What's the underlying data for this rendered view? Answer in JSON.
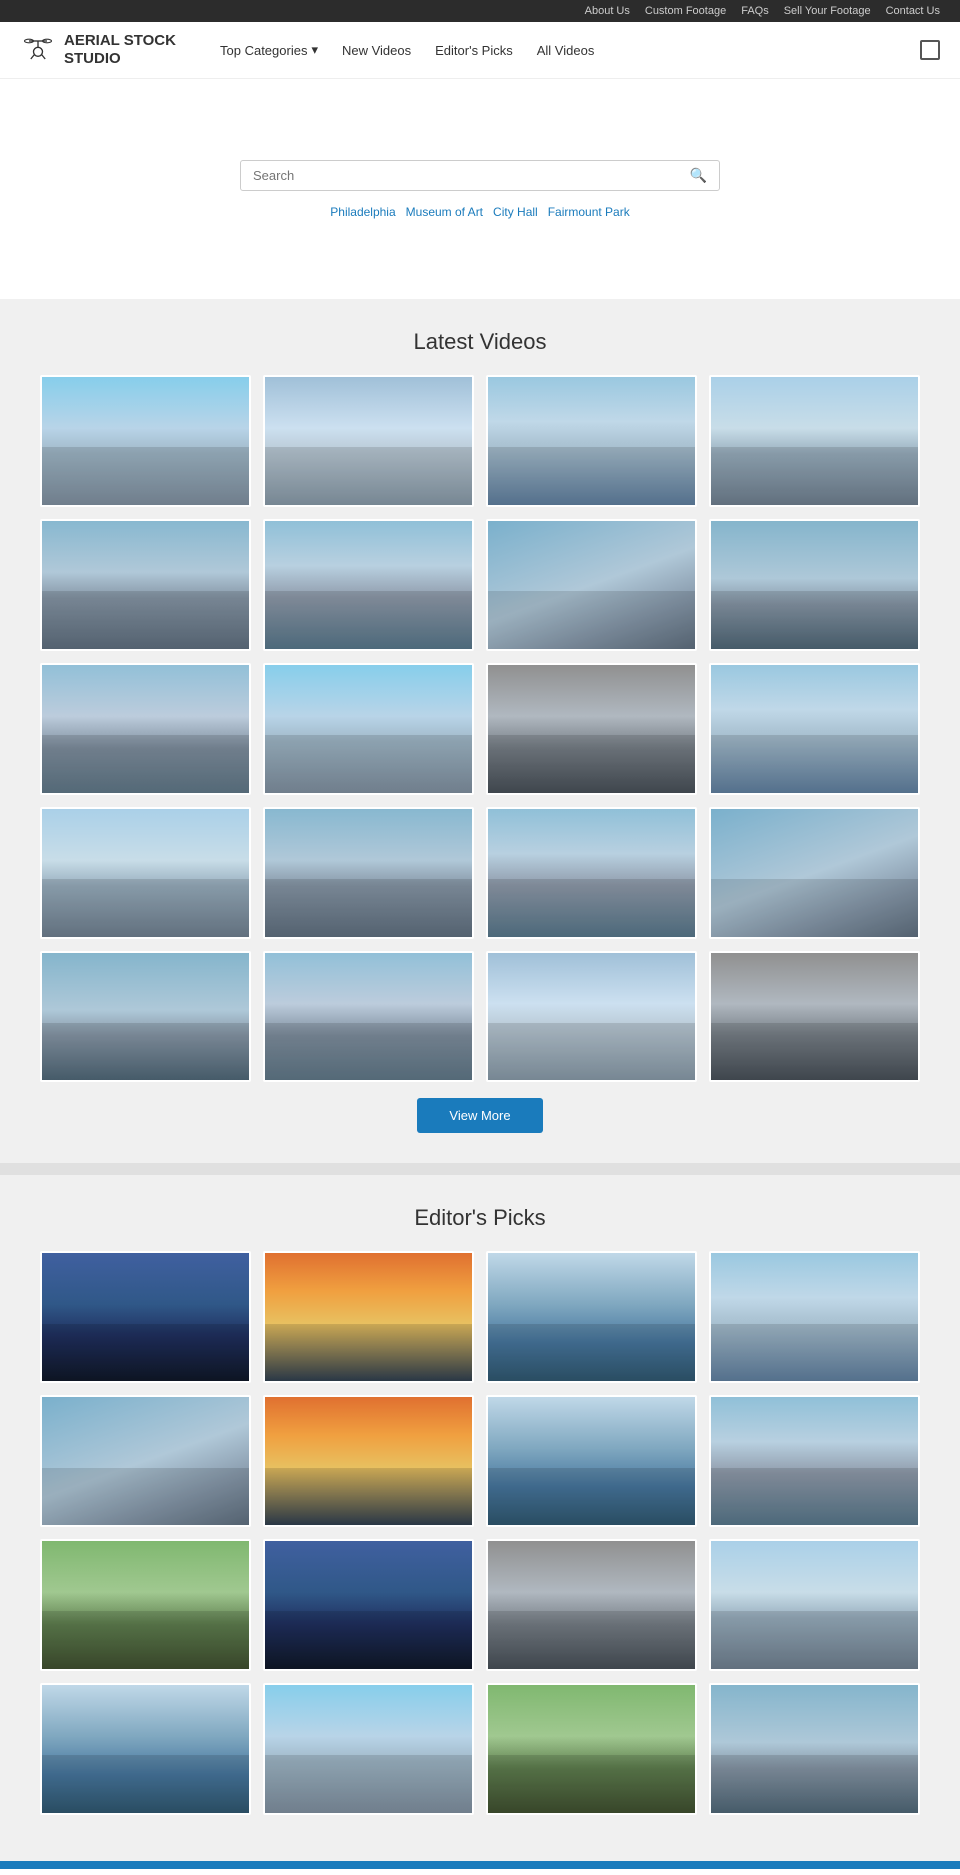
{
  "topBar": {
    "links": [
      "About Us",
      "Custom Footage",
      "FAQs",
      "Sell Your Footage",
      "Contact Us"
    ]
  },
  "header": {
    "logo": {
      "line1": "AERIAL STOCK",
      "line2": "STUDIO"
    },
    "nav": [
      {
        "label": "Top Categories",
        "hasDropdown": true
      },
      {
        "label": "New Videos"
      },
      {
        "label": "Editor's Picks"
      },
      {
        "label": "All Videos"
      }
    ]
  },
  "hero": {
    "search": {
      "placeholder": "Search"
    },
    "tags": [
      "Philadelphia",
      "Museum of Art",
      "City Hall",
      "Fairmount Park"
    ]
  },
  "latestVideos": {
    "title": "Latest Videos",
    "viewMore": "View More",
    "thumbCount": 20
  },
  "editorsPicks": {
    "title": "Editor's Picks",
    "thumbCount": 16
  }
}
